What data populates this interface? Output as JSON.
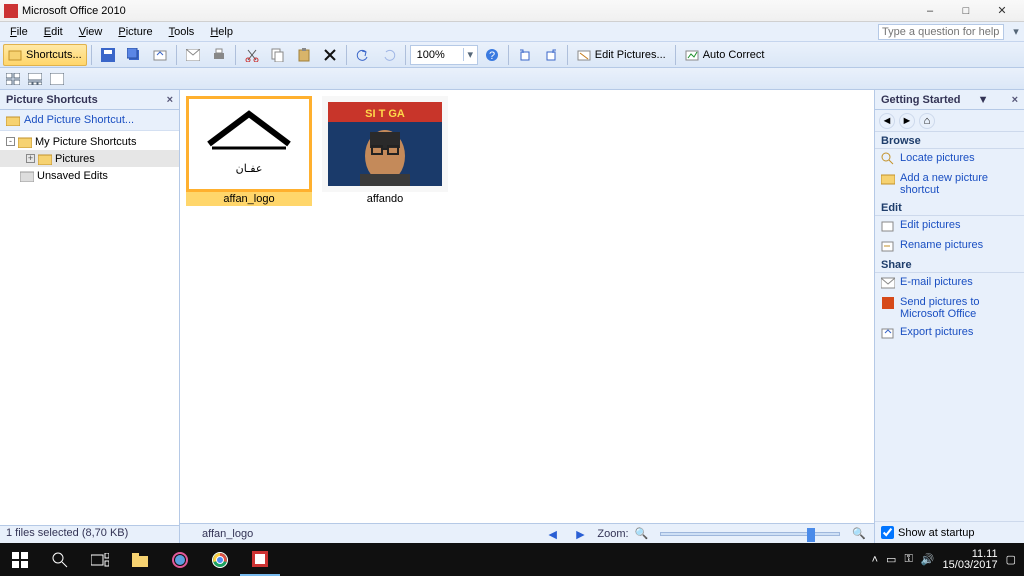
{
  "titlebar": {
    "title": "Microsoft Office 2010"
  },
  "menubar": {
    "items": [
      "File",
      "Edit",
      "View",
      "Picture",
      "Tools",
      "Help"
    ],
    "question_placeholder": "Type a question for help"
  },
  "toolbar": {
    "shortcuts_label": "Shortcuts...",
    "zoom_value": "100%",
    "edit_pictures_label": "Edit Pictures...",
    "auto_correct_label": "Auto Correct"
  },
  "sidebar": {
    "title": "Picture Shortcuts",
    "add_link": "Add Picture Shortcut...",
    "nodes": {
      "root": "My Picture Shortcuts",
      "pictures": "Pictures",
      "unsaved": "Unsaved Edits"
    },
    "status": "1 files selected (8,70 KB)"
  },
  "thumbs": [
    {
      "name": "affan_logo",
      "selected": true
    },
    {
      "name": "affando",
      "selected": false
    }
  ],
  "statusbar": {
    "filename": "affan_logo",
    "zoom_label": "Zoom:"
  },
  "rightpane": {
    "title": "Getting Started",
    "sections": {
      "browse": "Browse",
      "browse_links": {
        "locate": "Locate pictures",
        "add": "Add a new picture shortcut"
      },
      "edit": "Edit",
      "edit_links": {
        "edit": "Edit pictures",
        "rename": "Rename pictures"
      },
      "share": "Share",
      "share_links": {
        "email": "E-mail pictures",
        "send": "Send pictures to Microsoft Office",
        "export": "Export pictures"
      }
    },
    "show_startup": "Show at startup"
  },
  "taskbar": {
    "time": "11.11",
    "date": "15/03/2017"
  }
}
